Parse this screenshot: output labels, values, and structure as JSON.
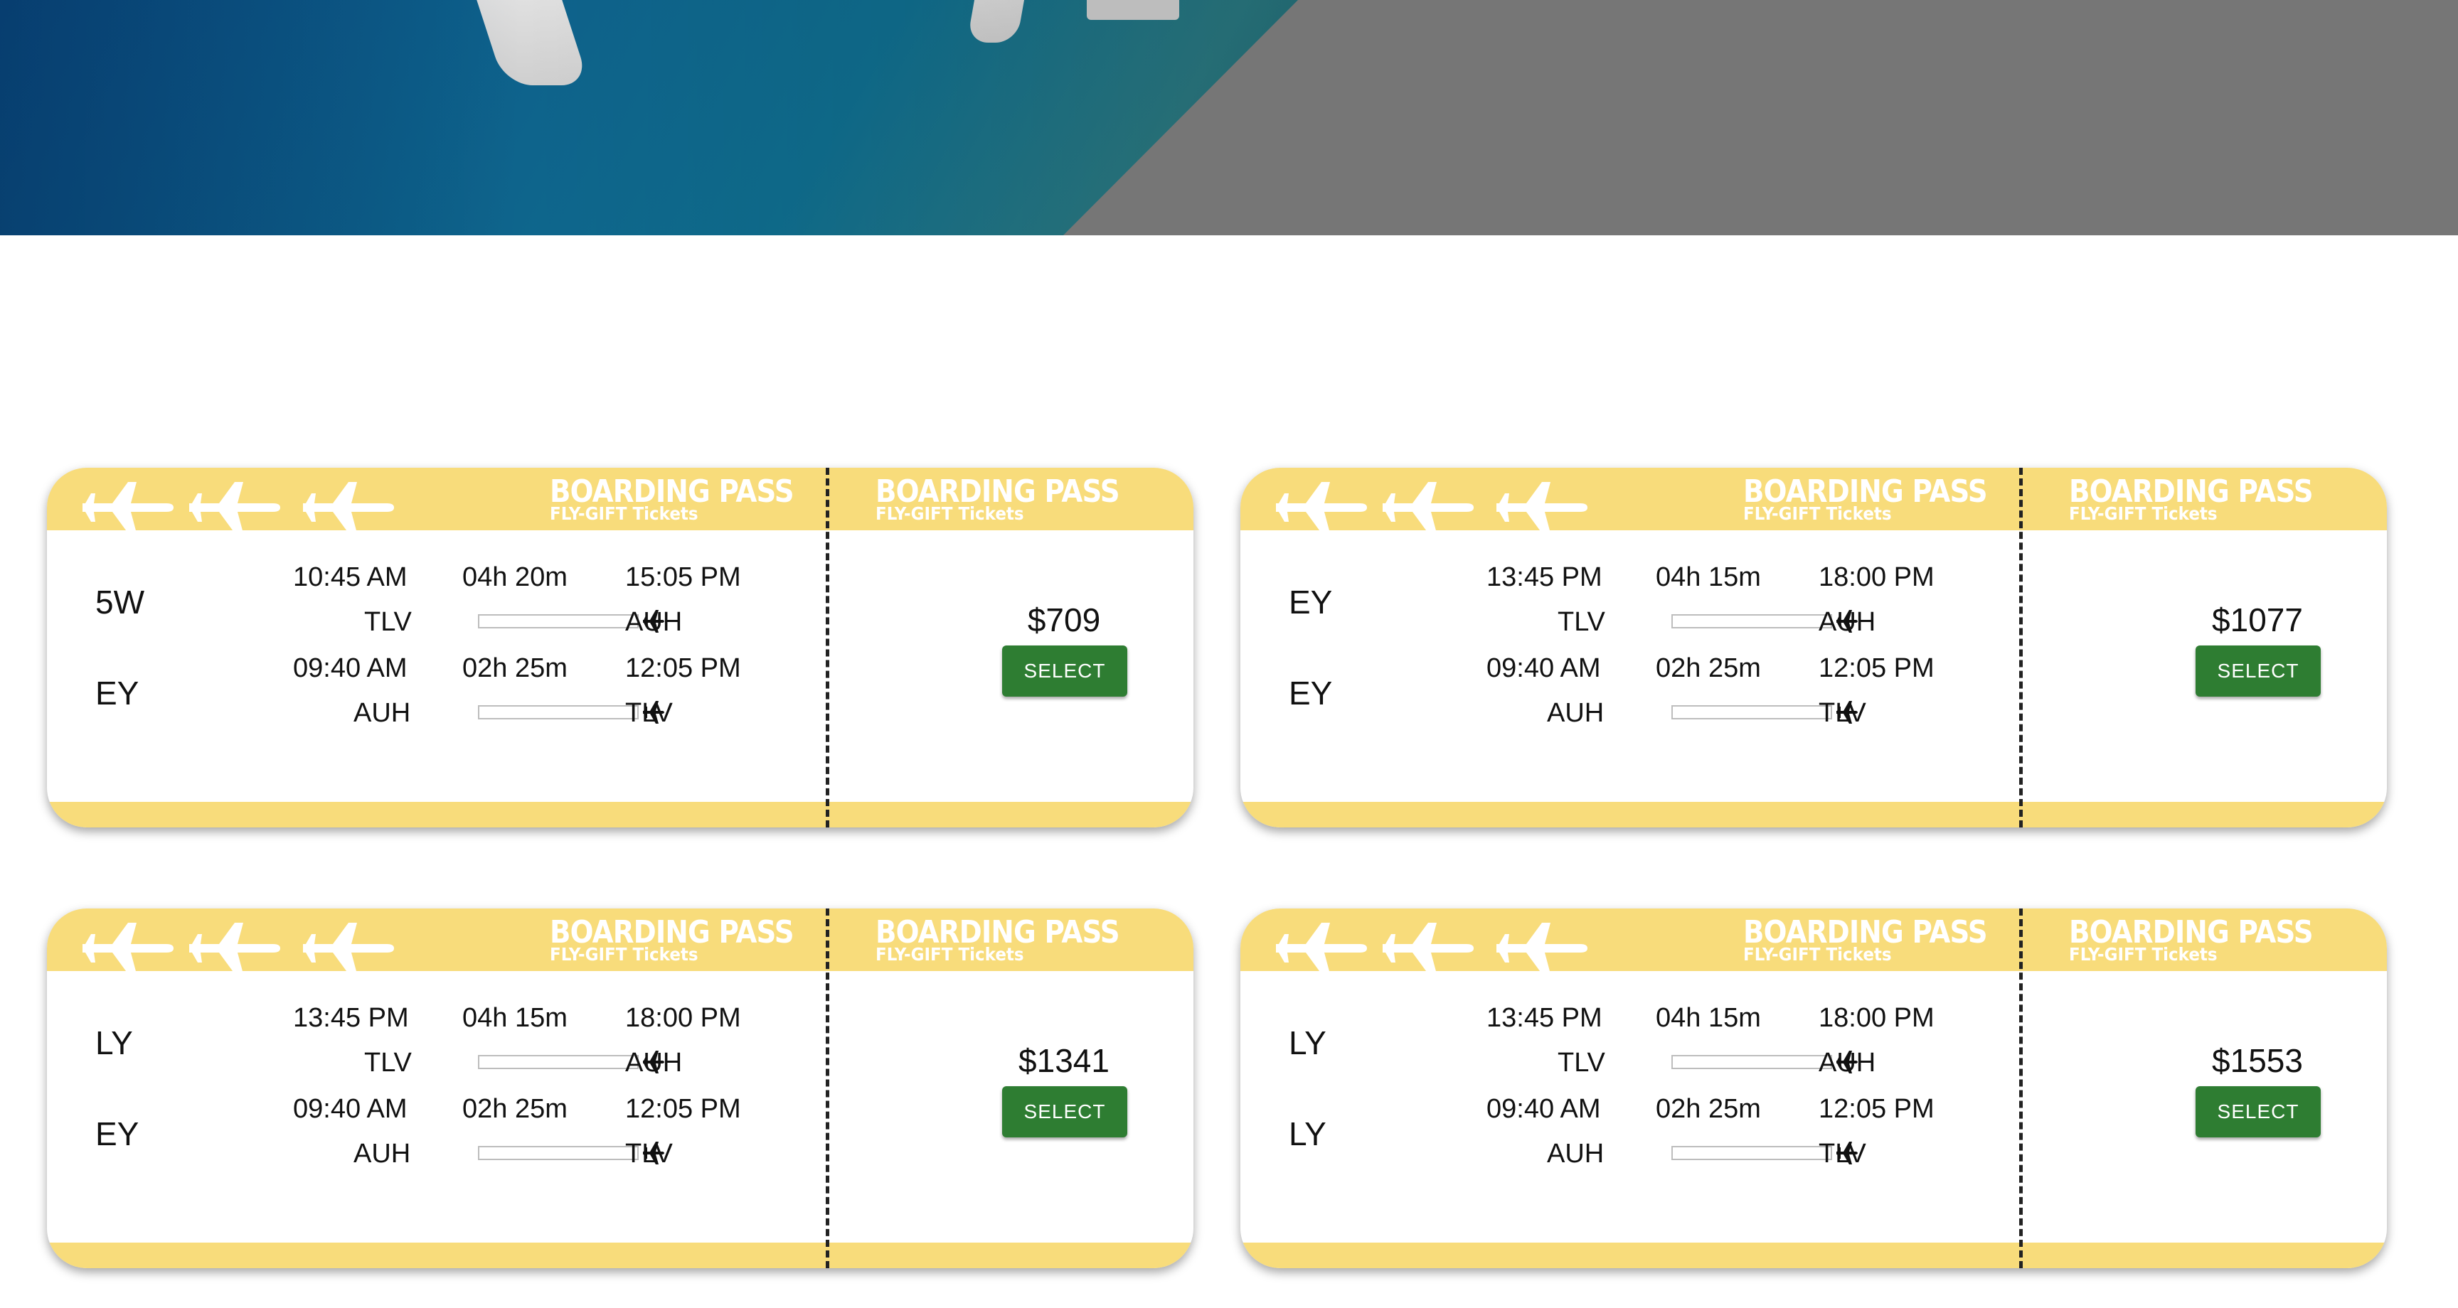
{
  "colors": {
    "ticket_band": "#f8dc7b",
    "select_button": "#2e7d32",
    "hero_gray": "#767676",
    "hero_blue": "#0b4f86"
  },
  "icons": [
    "airplane-icon"
  ],
  "tickets": [
    {
      "brand_title": "BOARDING PASS",
      "brand_subtitle": "FLY-GIFT Tickets",
      "stub_title": "BOARDING PASS",
      "stub_subtitle": "FLY-GIFT Tickets",
      "outbound": {
        "airline": "5W",
        "depart_time": "10:45 AM",
        "duration": "04h 20m",
        "arrive_time": "15:05 PM",
        "from": "TLV",
        "to": "AUH"
      },
      "return": {
        "airline": "EY",
        "depart_time": "09:40 AM",
        "duration": "02h 25m",
        "arrive_time": "12:05 PM",
        "from": "AUH",
        "to": "TLV"
      },
      "price": "$709",
      "select_label": "SELECT"
    },
    {
      "brand_title": "BOARDING PASS",
      "brand_subtitle": "FLY-GIFT Tickets",
      "stub_title": "BOARDING PASS",
      "stub_subtitle": "FLY-GIFT Tickets",
      "outbound": {
        "airline": "EY",
        "depart_time": "13:45 PM",
        "duration": "04h 15m",
        "arrive_time": "18:00 PM",
        "from": "TLV",
        "to": "AUH"
      },
      "return": {
        "airline": "EY",
        "depart_time": "09:40 AM",
        "duration": "02h 25m",
        "arrive_time": "12:05 PM",
        "from": "AUH",
        "to": "TLV"
      },
      "price": "$1077",
      "select_label": "SELECT"
    },
    {
      "brand_title": "BOARDING PASS",
      "brand_subtitle": "FLY-GIFT Tickets",
      "stub_title": "BOARDING PASS",
      "stub_subtitle": "FLY-GIFT Tickets",
      "outbound": {
        "airline": "LY",
        "depart_time": "13:45 PM",
        "duration": "04h 15m",
        "arrive_time": "18:00 PM",
        "from": "TLV",
        "to": "AUH"
      },
      "return": {
        "airline": "EY",
        "depart_time": "09:40 AM",
        "duration": "02h 25m",
        "arrive_time": "12:05 PM",
        "from": "AUH",
        "to": "TLV"
      },
      "price": "$1341",
      "select_label": "SELECT"
    },
    {
      "brand_title": "BOARDING PASS",
      "brand_subtitle": "FLY-GIFT Tickets",
      "stub_title": "BOARDING PASS",
      "stub_subtitle": "FLY-GIFT Tickets",
      "outbound": {
        "airline": "LY",
        "depart_time": "13:45 PM",
        "duration": "04h 15m",
        "arrive_time": "18:00 PM",
        "from": "TLV",
        "to": "AUH"
      },
      "return": {
        "airline": "LY",
        "depart_time": "09:40 AM",
        "duration": "02h 25m",
        "arrive_time": "12:05 PM",
        "from": "AUH",
        "to": "TLV"
      },
      "price": "$1553",
      "select_label": "SELECT"
    }
  ]
}
